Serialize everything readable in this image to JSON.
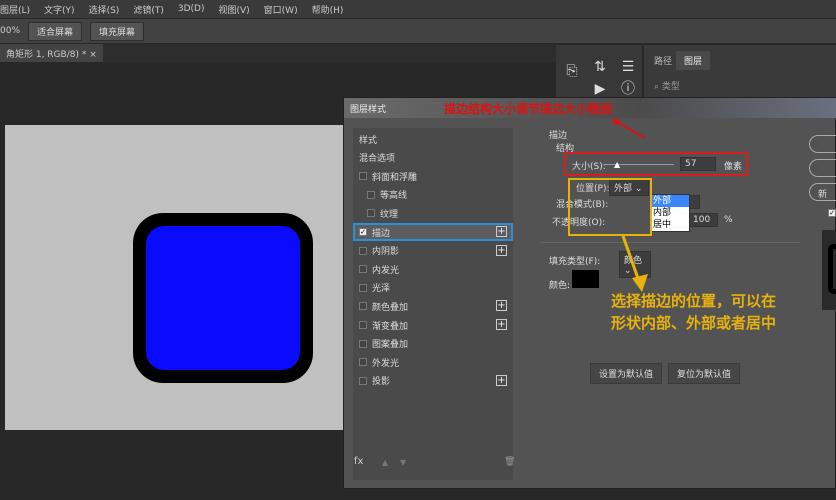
{
  "menu": [
    "图层(L)",
    "文字(Y)",
    "选择(S)",
    "滤镜(T)",
    "3D(D)",
    "视图(V)",
    "窗口(W)",
    "帮助(H)"
  ],
  "options": {
    "zoom": "00%",
    "fit_screen": "适合屏幕",
    "fill_screen": "填充屏幕"
  },
  "doc_tab": "角矩形 1, RGB/8) *",
  "doc_close": "×",
  "layers_panel": {
    "tabs": [
      "路径",
      "图层"
    ],
    "search": "类型"
  },
  "shape_colors": {
    "fill": "#0a0aff",
    "stroke": "#000000"
  },
  "dialog": {
    "title": "图层样式",
    "annotation_red": "描边结构大小调节描边大小粗细",
    "list": [
      {
        "label": "样式",
        "check": null,
        "plus": false
      },
      {
        "label": "混合选项",
        "check": null,
        "plus": false
      },
      {
        "label": "斜面和浮雕",
        "check": false,
        "plus": false
      },
      {
        "label": "等高线",
        "check": false,
        "plus": false
      },
      {
        "label": "纹理",
        "check": false,
        "plus": false
      },
      {
        "label": "描边",
        "check": true,
        "plus": true
      },
      {
        "label": "内阴影",
        "check": false,
        "plus": true
      },
      {
        "label": "内发光",
        "check": false,
        "plus": false
      },
      {
        "label": "光泽",
        "check": false,
        "plus": false
      },
      {
        "label": "颜色叠加",
        "check": false,
        "plus": true
      },
      {
        "label": "渐变叠加",
        "check": false,
        "plus": true
      },
      {
        "label": "图案叠加",
        "check": false,
        "plus": false
      },
      {
        "label": "外发光",
        "check": false,
        "plus": false
      },
      {
        "label": "投影",
        "check": false,
        "plus": true
      }
    ],
    "footer_icons": [
      "fx",
      "▲",
      "▼",
      "🗑"
    ],
    "section": "描边",
    "structure": "结构",
    "size_label": "大小(S):",
    "size_value": "57",
    "size_unit": "像素",
    "size_slider": 0.2,
    "position_label": "位置(P):",
    "position_value": "外部",
    "blend_label": "混合模式(B):",
    "opacity_label": "不透明度(O):",
    "opacity_value": "100",
    "opacity_unit": "%",
    "position_options": [
      "外部",
      "内部",
      "居中"
    ],
    "fill_type_label": "填充类型(F):",
    "fill_type_value": "颜色",
    "color_label": "颜色:",
    "stroke_color": "#000000",
    "annotation_yellow": [
      "选择描边的位置，可以在",
      "形状内部、外部或者居中"
    ],
    "set_default": "设置为默认值",
    "reset_default": "复位为默认值",
    "new_style_partial": "新"
  }
}
